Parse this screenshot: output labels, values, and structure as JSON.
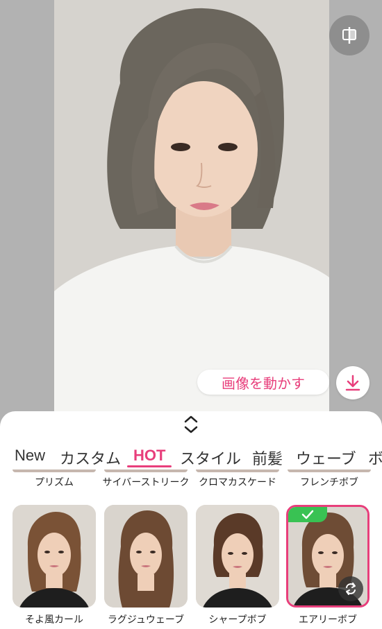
{
  "preview": {
    "compare_icon": "split-compare-icon",
    "move_image_label": "画像を動かす",
    "download_icon": "download-icon"
  },
  "sheet": {
    "handle_icon": "expand-collapse-chevrons-icon",
    "tabs": [
      {
        "label": "New"
      },
      {
        "label": "カスタム"
      },
      {
        "label": "HOT",
        "active": true
      },
      {
        "label": "スタイル"
      },
      {
        "label": "前髪"
      },
      {
        "label": "ウェーブ"
      },
      {
        "label": "ボ"
      }
    ],
    "previous_row": [
      "プリズム",
      "サイバーストリーク",
      "クロマカスケード",
      "フレンチボブ"
    ],
    "styles": [
      {
        "label": "そよ風カール"
      },
      {
        "label": "ラグジュウェーブ"
      },
      {
        "label": "シャープボブ"
      },
      {
        "label": "エアリーボブ",
        "selected": true
      }
    ]
  },
  "colors": {
    "accent": "#e83e7b",
    "check_green": "#39c253",
    "letterbox_gray": "#b2b2b2"
  }
}
